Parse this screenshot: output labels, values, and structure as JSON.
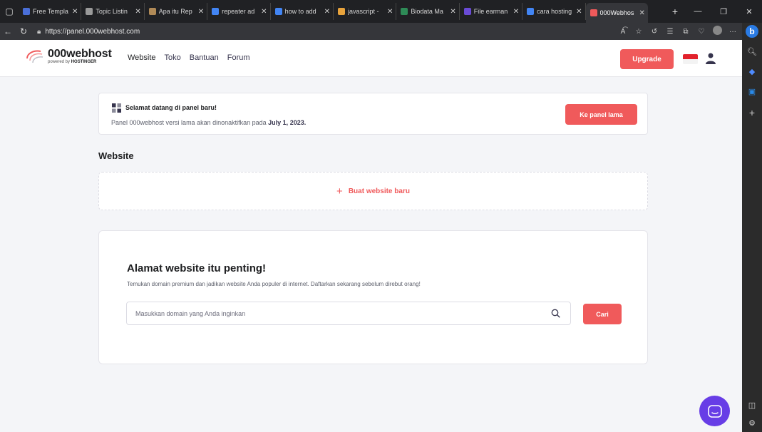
{
  "browser": {
    "tabs": [
      {
        "label": "Free Templa",
        "color": "#4a6fd8"
      },
      {
        "label": "Topic Listin",
        "color": "#9a9a9a"
      },
      {
        "label": "Apa itu Rep",
        "color": "#b08a57"
      },
      {
        "label": "repeater ad",
        "color": "#4285f4"
      },
      {
        "label": "how to add",
        "color": "#4285f4"
      },
      {
        "label": "javascript -",
        "color": "#e8a33c"
      },
      {
        "label": "Biodata Ma",
        "color": "#2e8b57"
      },
      {
        "label": "File earman",
        "color": "#6a4bd6"
      },
      {
        "label": "cara hosting",
        "color": "#4285f4"
      },
      {
        "label": "000Webhos",
        "color": "#f05a5b"
      }
    ],
    "active_tab_label": "000Webhos",
    "url": "https://panel.000webhost.com"
  },
  "header": {
    "logo_name": "000webhost",
    "logo_sub_prefix": "powered by",
    "logo_sub_brand": "HOSTINGER",
    "nav": [
      "Website",
      "Toko",
      "Bantuan",
      "Forum"
    ],
    "upgrade_label": "Upgrade"
  },
  "notice": {
    "title": "Selamat datang di panel baru!",
    "text": "Panel 000webhost versi lama akan dinonaktifkan pada",
    "date": "July 1, 2023.",
    "button_label": "Ke panel lama"
  },
  "website_section": {
    "title": "Website",
    "new_site_label": "Buat website baru"
  },
  "domain": {
    "title": "Alamat website itu penting!",
    "description": "Temukan domain premium dan jadikan website Anda populer di internet. Daftarkan sekarang sebelum direbut orang!",
    "placeholder": "Masukkan domain yang Anda inginkan",
    "value": "",
    "button_label": "Cari"
  },
  "colors": {
    "accent": "#f05a5b",
    "chat": "#673de6"
  }
}
